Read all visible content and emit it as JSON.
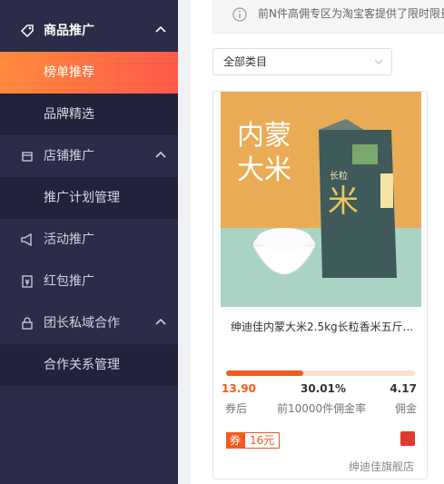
{
  "sidebar": {
    "groups": [
      {
        "label": "商品推广",
        "subs": [
          "榜单推荐",
          "品牌精选"
        ]
      },
      {
        "label": "店铺推广",
        "subs": [
          "推广计划管理"
        ]
      },
      {
        "label": "活动推广"
      },
      {
        "label": "红包推广"
      },
      {
        "label": "团长私域合作",
        "subs": [
          "合作关系管理"
        ]
      }
    ]
  },
  "notice": {
    "text": "前N件高佣专区为淘宝客提供了限时限量"
  },
  "filter": {
    "category_selected": "全部类目"
  },
  "product": {
    "image_text": {
      "line1": "内蒙",
      "line2": "大米",
      "pack_main": "米",
      "pack_tag": "长粒"
    },
    "name": "绅迪佳内蒙大米2.5kg长粒香米五斤...",
    "progress_fraction": 0.41,
    "price_after_coupon": "13.90",
    "price_label": "券后",
    "commission_rate": "30.01%",
    "commission_rate_label": "前10000件佣金率",
    "commission": "4.17",
    "commission_label": "佣金",
    "coupon_badge": "券",
    "coupon_amount": "16元",
    "shop_name": "绅迪佳旗舰店"
  },
  "colors": {
    "accent": "#f25a1e",
    "sidebar": "#2b2c47",
    "sidebar_sub": "#22233a"
  }
}
